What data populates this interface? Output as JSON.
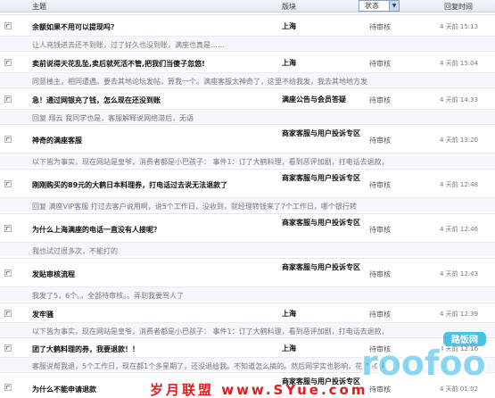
{
  "header": {
    "title_col": "主题",
    "board_col": "版块",
    "status_select": "状态",
    "time_col": "回复时间"
  },
  "rows": [
    {
      "title": "余额如果不用可以提现吗？",
      "board": "上海",
      "status": "待审核",
      "time": "4 天前 15:13",
      "reply": "让人充钱进去还不到账，过了好久也没到账，满座也真是……"
    },
    {
      "title": "卖前说得天花乱坠,卖后就死活不管,把我们当傻子忽悠!",
      "board": "上海",
      "status": "待审核",
      "time": "4 天前 15:04",
      "reply": "同意楼主，相同遭遇。要去其地论坛发帖，算我一个。满座客服太神奇了，这里不给我发，我去其地地方发"
    },
    {
      "title": "急！通过网银充了钱，怎么现在还没到账",
      "board": "满座公告与会员答疑",
      "status": "待审核",
      "time": "4 天前 14:33",
      "reply": "回复 翔云   我同学也是，客服解释说网络滞后，无语"
    },
    {
      "title": "神奇的满座客服",
      "board": "商家客服与用户投诉专区",
      "status": "待审核",
      "time": "4 天前 13:20",
      "reply": "以下皆为事实，现在网站是皇爷，消费者都是小巴孩子：  事件1：订了大鹤料理，看到恶评加剧，打电话去退款，"
    },
    {
      "title": "刚刚购买的89元的大鹤日本料理券，打电话过去说无法退款了",
      "board": "商家客服与用户投诉专区",
      "status": "待审核",
      "time": "4 天前 12:48",
      "reply": "回复 满座VIP客服  打过去客户说用啊，说5个工作日，没收到，就经理转钱来了7个工作日，哪个银行转"
    },
    {
      "title": "为什么上海满座的电话一直没有人接呢？",
      "board": "商家客服与用户投诉专区",
      "status": "待审核",
      "time": "4 天前 12:46",
      "reply": "我也试过很多次，不能打的"
    },
    {
      "title": "发贴审核流程",
      "board": "商家客服与用户投诉专区",
      "status": "待审核",
      "time": "4 天前 12:43",
      "reply": "我发了5，6个。。全部待审核。。弄到我要骂人了"
    },
    {
      "title": "发牢骚",
      "board": "上海",
      "status": "待审核",
      "time": "4 天前 12:39",
      "reply": "以下皆为事实，现在网站是皇爷，消费者都是小巴孩子：  事件1：订了大鹤料理，看到恶评加剧，打电话去退款，"
    },
    {
      "title": "团了大鹤料理的券，我要退款！！",
      "board": "上海",
      "status": "待审核",
      "time": "4 天前 12:16",
      "reply": "客服说帮我退，5个工作日，现在都1个多星期了，还没退给我。不知道怎么搞的。然后网学实也影响，花了50块"
    },
    {
      "title": "为什么不能申请退款",
      "board": "商家客服与用户投诉专区",
      "status": "待审核",
      "time": "4 天前 01:02",
      "reply": ""
    }
  ],
  "watermark": {
    "text": "岁月联盟 www.SYue.com",
    "logo_text": "roofoo",
    "logo_small": "路饭网"
  },
  "colors": {
    "header_bg": "#e3e9f1",
    "sub_bg": "#f4f7fb",
    "watermark_red": "#e21c1c",
    "logo_blue": "#2fb6e3"
  }
}
